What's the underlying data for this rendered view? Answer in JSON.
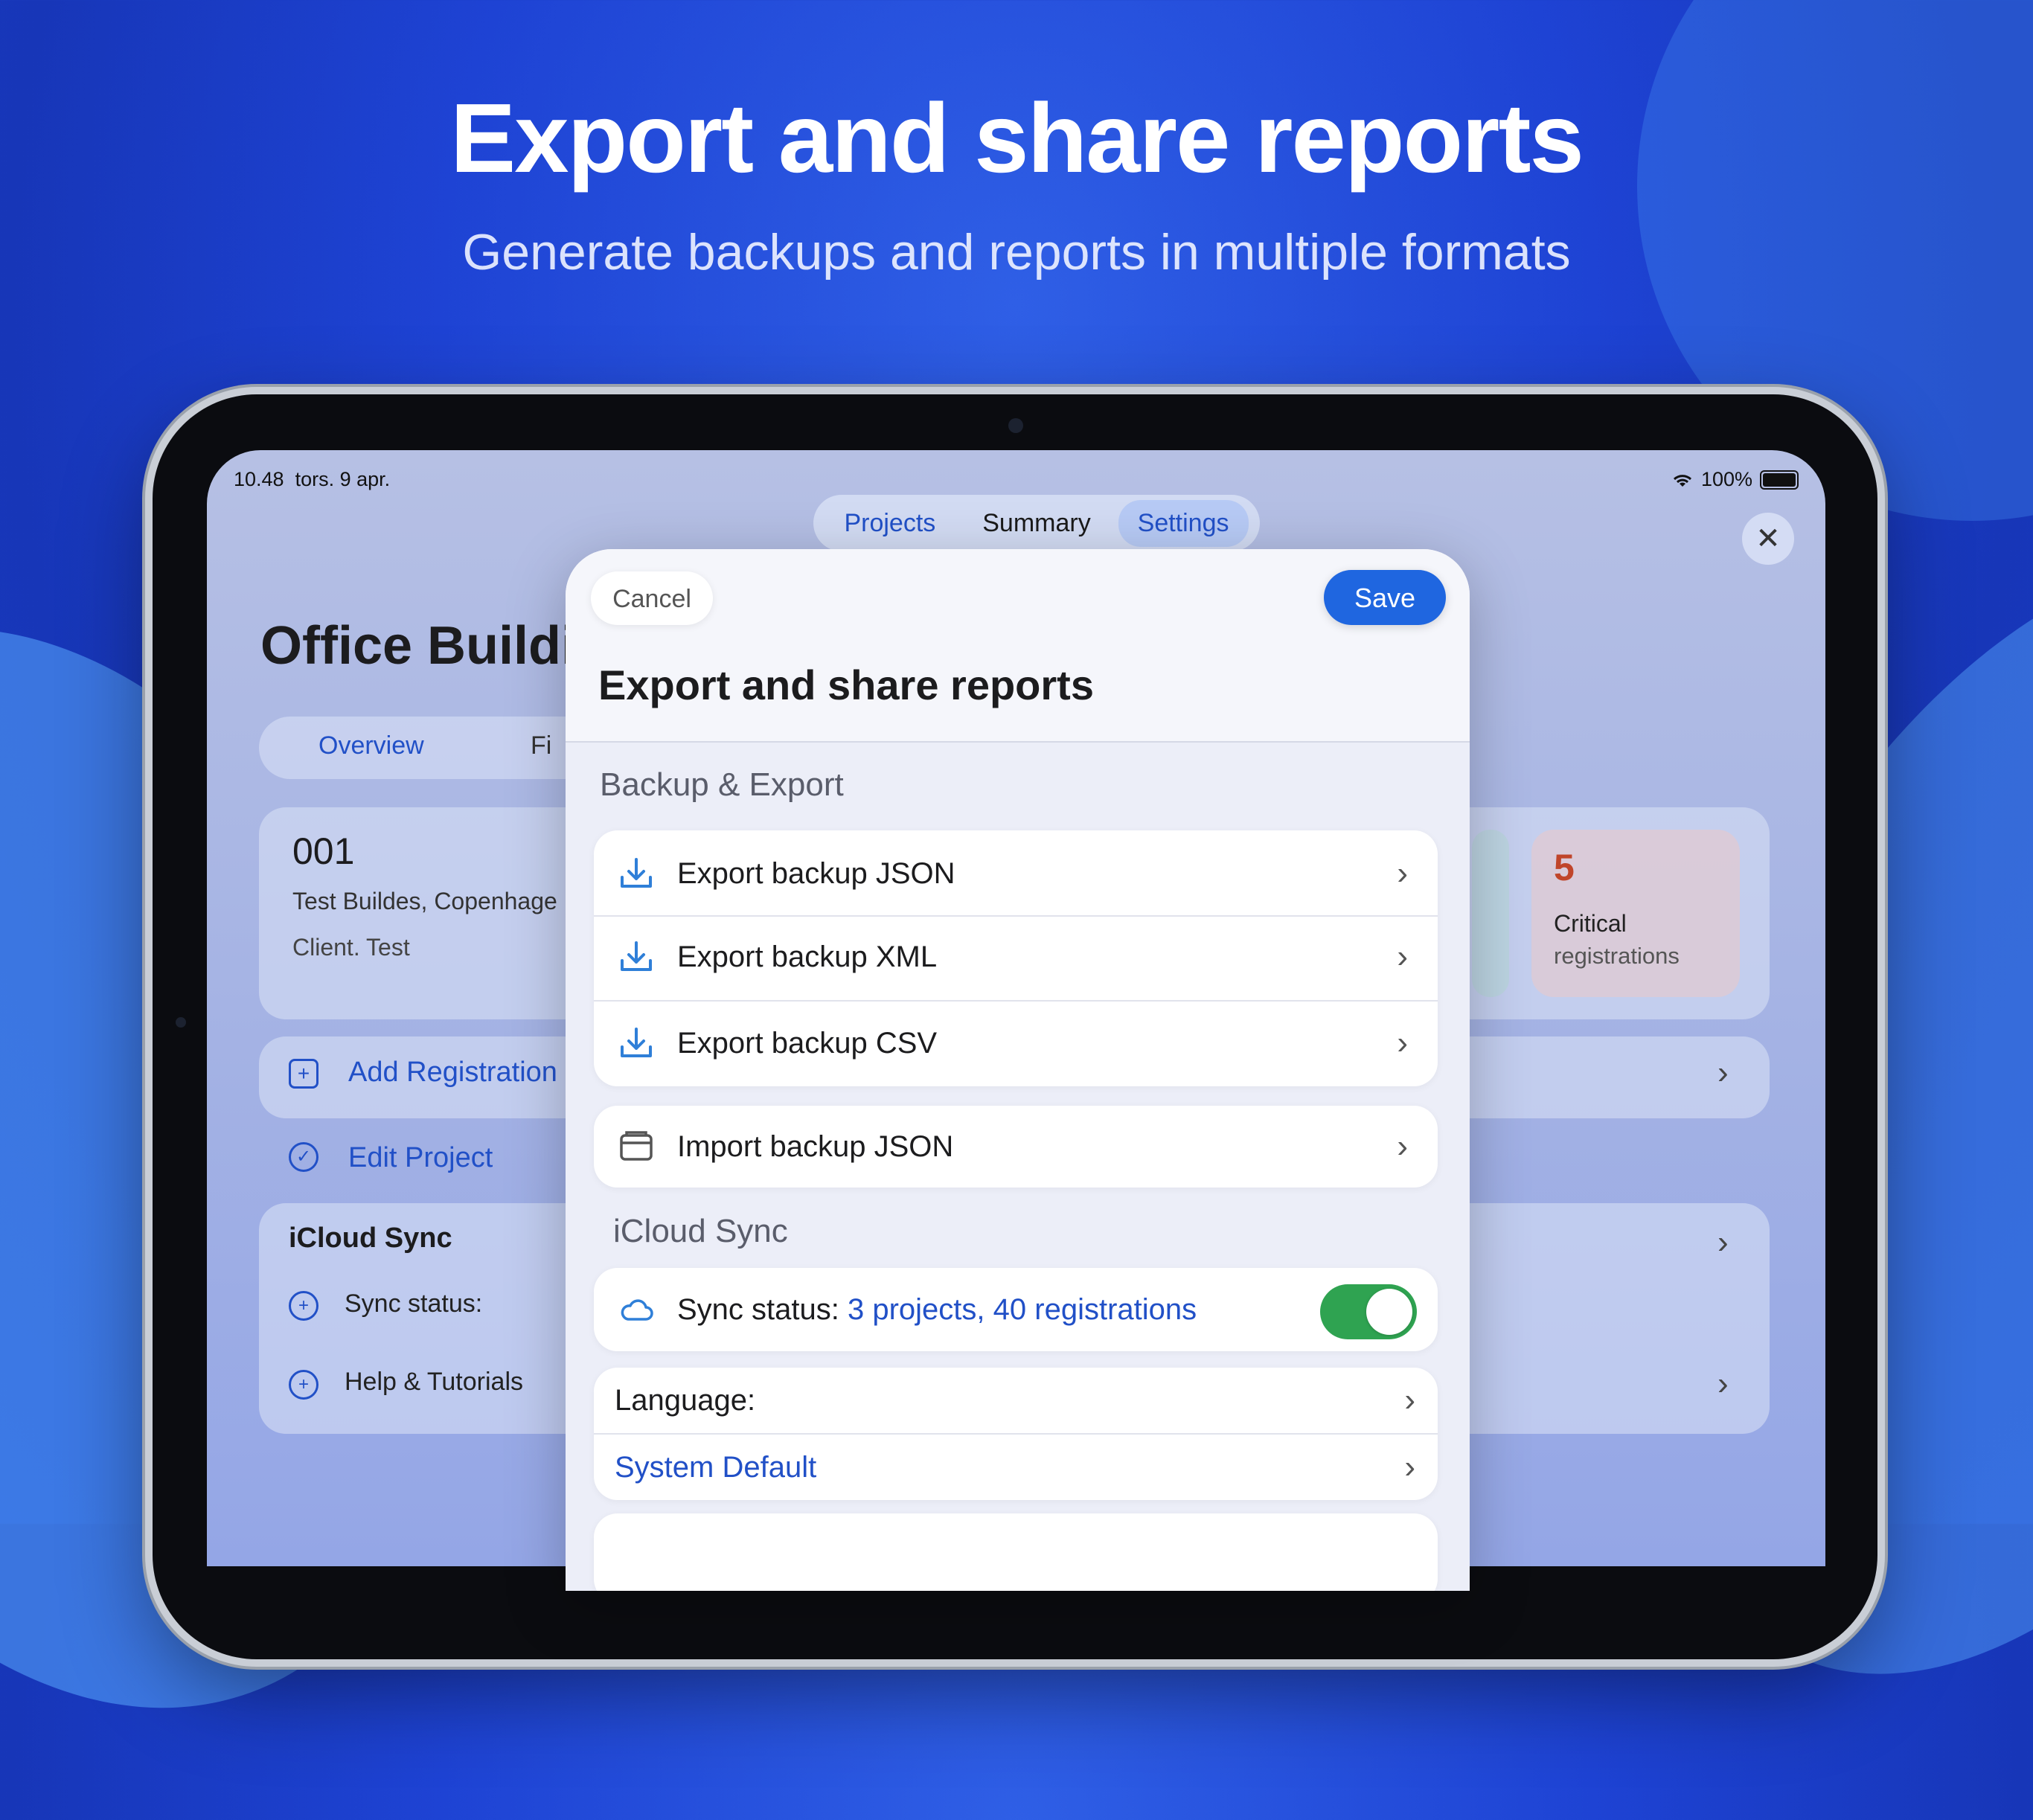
{
  "promo": {
    "headline": "Export and share reports",
    "subline": "Generate backups and reports in multiple formats"
  },
  "status_bar": {
    "time": "10.48",
    "date": "tors. 9 apr.",
    "battery": "100%"
  },
  "top_segment": {
    "items": [
      "Projects",
      "Summary",
      "Settings"
    ],
    "selected": "Settings"
  },
  "background_app": {
    "title": "Office Buildi",
    "tabs": [
      "Overview",
      "Fi"
    ],
    "project_number": "001",
    "address": "Test Buildes, Copenhage",
    "client": "Client. Test",
    "critical_count": "5",
    "critical_label": "Critical",
    "critical_sub": "registrations",
    "add_registration": "Add Registration",
    "edit_project": "Edit Project",
    "icloud_section": "iCloud Sync",
    "sync_status": "Sync status:",
    "help": "Help & Tutorials"
  },
  "sheet": {
    "cancel": "Cancel",
    "save": "Save",
    "title": "Export and share reports",
    "backup_section": "Backup & Export",
    "export_items": [
      "Export backup JSON",
      "Export backup XML",
      "Export backup CSV"
    ],
    "import_item": "Import backup JSON",
    "icloud_section": "iCloud Sync",
    "sync_label": "Sync status:",
    "sync_value": "3 projects, 40 registrations",
    "sync_enabled": true,
    "language_label": "Language:",
    "language_value": "System Default"
  },
  "colors": {
    "accent": "#1f66e0",
    "link": "#2150c7",
    "toggle_on": "#2fa351",
    "critical": "#c0452a"
  }
}
